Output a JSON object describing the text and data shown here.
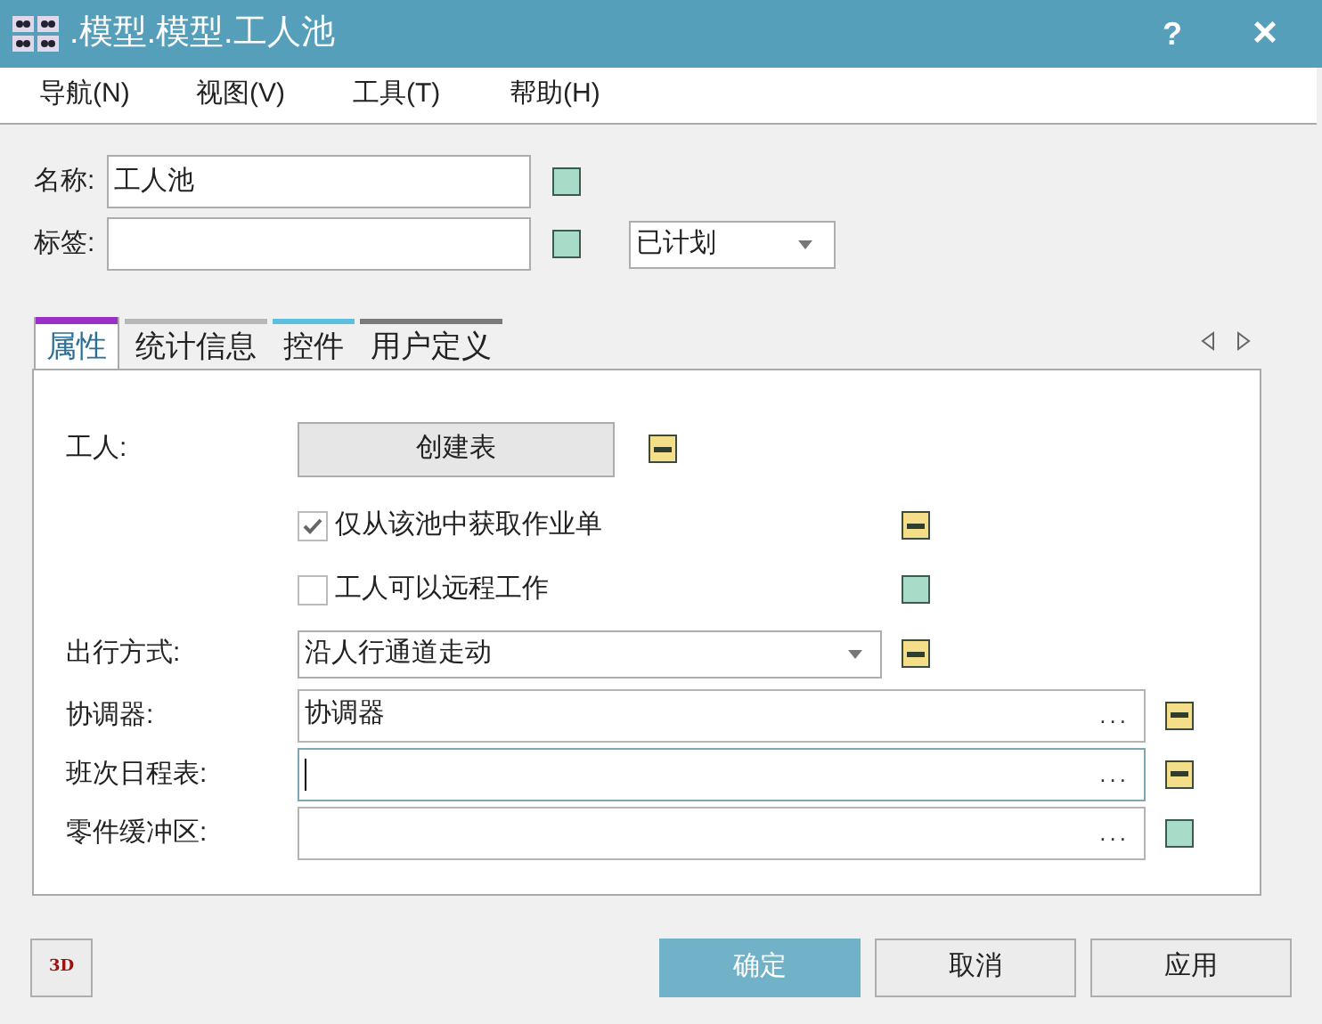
{
  "window": {
    "title": ".模型.模型.工人池",
    "help": "?",
    "close": "×"
  },
  "menu": [
    {
      "label": "导航(N)"
    },
    {
      "label": "视图(V)"
    },
    {
      "label": "工具(T)"
    },
    {
      "label": "帮助(H)"
    }
  ],
  "header": {
    "name_label": "名称:",
    "name_value": "工人池",
    "name_inherited": false,
    "tag_label": "标签:",
    "tag_inherited": false,
    "status_value": "已计划"
  },
  "tabs": [
    {
      "label": "属性",
      "selected": true,
      "color": "#9b30c8"
    },
    {
      "label": "统计信息",
      "selected": false,
      "color": "#b8b8b8"
    },
    {
      "label": "控件",
      "selected": false,
      "color": "#5bc0de"
    },
    {
      "label": "用户定义",
      "selected": false,
      "color": "#7a7a7a"
    }
  ],
  "rows": [
    {
      "kind": "button",
      "label": "工人:",
      "text": "创建表",
      "inherited": true
    },
    {
      "kind": "checkbox",
      "text": "仅从该池中获取作业单",
      "checked": true,
      "inherited": true
    },
    {
      "kind": "checkbox",
      "text": "工人可以远程工作",
      "checked": false,
      "inherited": false
    },
    {
      "kind": "select",
      "label": "出行方式:",
      "value": "沿人行通道走动",
      "inherited": true
    },
    {
      "kind": "picker",
      "label": "协调器:",
      "value": "协调器",
      "focused": false,
      "browse": "...",
      "inherited": true
    },
    {
      "kind": "picker",
      "label": "班次日程表:",
      "value": "",
      "focused": true,
      "browse": "...",
      "inherited": true
    },
    {
      "kind": "picker",
      "label": "零件缓冲区:",
      "value": "",
      "focused": false,
      "browse": "...",
      "inherited": false
    }
  ],
  "footer": {
    "view_3d": "3D",
    "buttons": [
      {
        "label": "确定",
        "primary": true
      },
      {
        "label": "取消",
        "primary": false
      },
      {
        "label": "应用",
        "primary": false
      }
    ]
  }
}
